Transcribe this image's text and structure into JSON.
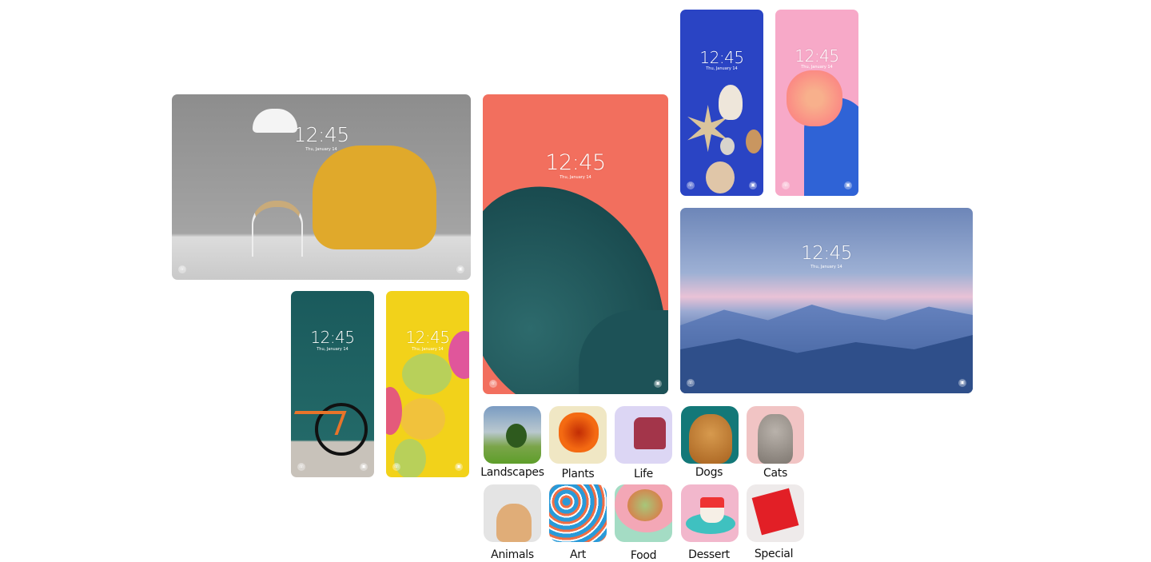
{
  "lockscreen": {
    "time": "12:45",
    "date": "Thu, January 14"
  },
  "wallpapers": [
    {
      "id": "chair",
      "bg": "#9a9a9a"
    },
    {
      "id": "bicycle",
      "bg": "#1f5f5f"
    },
    {
      "id": "macarons",
      "bg": "#f2d21a"
    },
    {
      "id": "monstera-leaf",
      "bg": "#f26f5e"
    },
    {
      "id": "seashells",
      "bg": "#2a44c4"
    },
    {
      "id": "cactus-flower",
      "bg": "#f7a9c8"
    },
    {
      "id": "mountains",
      "bg": "#6f88b8"
    }
  ],
  "categories": [
    {
      "label": "Landscapes"
    },
    {
      "label": "Plants"
    },
    {
      "label": "Life"
    },
    {
      "label": "Dogs"
    },
    {
      "label": "Cats"
    },
    {
      "label": "Animals"
    },
    {
      "label": "Art"
    },
    {
      "label": "Food"
    },
    {
      "label": "Dessert"
    },
    {
      "label": "Special"
    }
  ],
  "icons": {
    "left": "phone-icon",
    "right": "camera-icon"
  }
}
